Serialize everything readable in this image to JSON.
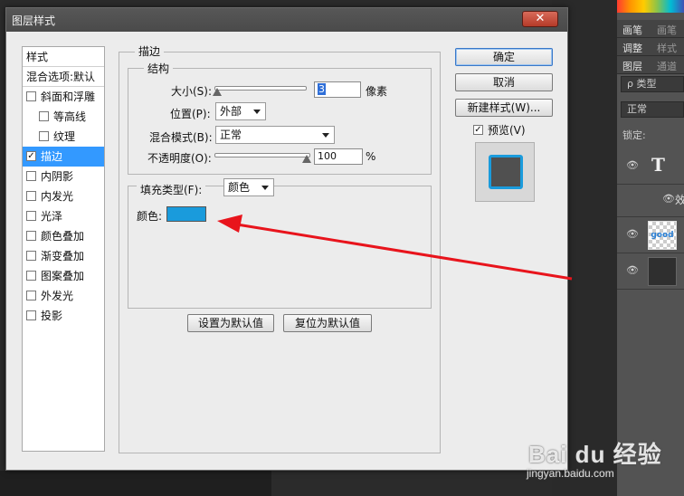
{
  "dialog": {
    "title": "图层样式",
    "close_label": "✕"
  },
  "style_list": {
    "header": "样式",
    "blend_options": "混合选项:默认",
    "items": [
      {
        "label": "斜面和浮雕",
        "checked": false
      },
      {
        "label": "等高线",
        "checked": false
      },
      {
        "label": "纹理",
        "checked": false
      },
      {
        "label": "描边",
        "checked": true
      },
      {
        "label": "内阴影",
        "checked": false
      },
      {
        "label": "内发光",
        "checked": false
      },
      {
        "label": "光泽",
        "checked": false
      },
      {
        "label": "颜色叠加",
        "checked": false
      },
      {
        "label": "渐变叠加",
        "checked": false
      },
      {
        "label": "图案叠加",
        "checked": false
      },
      {
        "label": "外发光",
        "checked": false
      },
      {
        "label": "投影",
        "checked": false
      }
    ],
    "check_glyph": "✓"
  },
  "stroke": {
    "section_title": "描边",
    "structure_title": "结构",
    "size_label": "大小(S):",
    "size_value": "3",
    "size_unit": "像素",
    "position_label": "位置(P):",
    "position_value": "外部",
    "blend_label": "混合模式(B):",
    "blend_value": "正常",
    "opacity_label": "不透明度(O):",
    "opacity_value": "100",
    "opacity_unit": "%",
    "fill_type_label": "填充类型(F):",
    "fill_type_value": "颜色",
    "color_label": "颜色:",
    "color_hex": "#1a9bdc",
    "set_default_button": "设置为默认值",
    "reset_default_button": "复位为默认值"
  },
  "actions": {
    "ok": "确定",
    "cancel": "取消",
    "new_style": "新建样式(W)...",
    "preview_label": "预览(V)",
    "preview_checked": true
  },
  "layers_panel": {
    "tab_swatches": "画笔",
    "tab_swatches2": "画笔预",
    "tab_adjust": "调整",
    "tab_styles": "样式",
    "tab_layers": "图层",
    "tab_channels": "通道",
    "filter_label": "ρ 类型",
    "blend_mode": "正常",
    "lock_label": "锁定:",
    "layer_text_thumb": "T",
    "layer_good_thumb": "good",
    "effect_label": "效"
  },
  "watermark": {
    "logo": "Bai du 经验",
    "url": "jingyan.baidu.com"
  },
  "accent_color": "#3399ff",
  "arrow_color": "#e8141c"
}
